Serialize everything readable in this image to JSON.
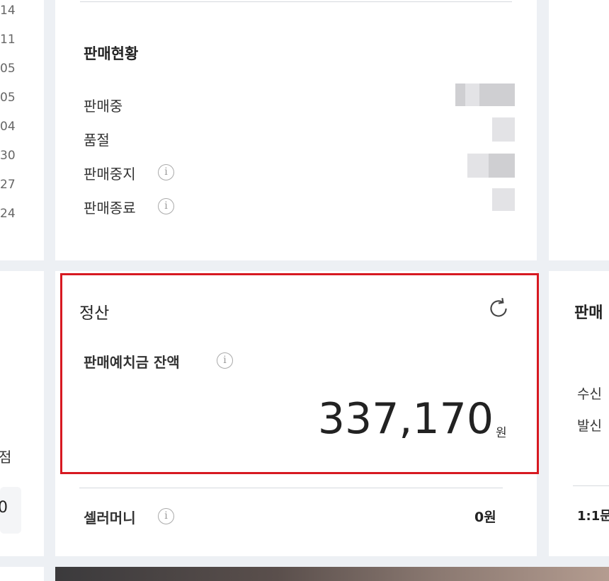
{
  "left_dates": [
    "14",
    "11",
    "05",
    "05",
    "04",
    "30",
    "27",
    "24"
  ],
  "left_mid": {
    "partial_label": "점",
    "partial_value": "0"
  },
  "sales_status": {
    "title": "판매현황",
    "rows": [
      {
        "label": "판매중",
        "info": false
      },
      {
        "label": "품절",
        "info": false
      },
      {
        "label": "판매중지",
        "info": true
      },
      {
        "label": "판매종료",
        "info": true
      }
    ]
  },
  "settlement": {
    "title": "정산",
    "balance_label": "판매예치금 잔액",
    "balance_value": "337,170",
    "balance_unit": "원",
    "seller_money_label": "셀러머니",
    "seller_money_value": "0원"
  },
  "right_mid": {
    "partial_title": "판매",
    "rows": [
      "수신",
      "발신"
    ],
    "bottom_label": "1:1문"
  },
  "icons": {
    "info": "info-icon",
    "refresh": "refresh-icon"
  },
  "colors": {
    "highlight": "#d71921",
    "background": "#edf0f4"
  }
}
